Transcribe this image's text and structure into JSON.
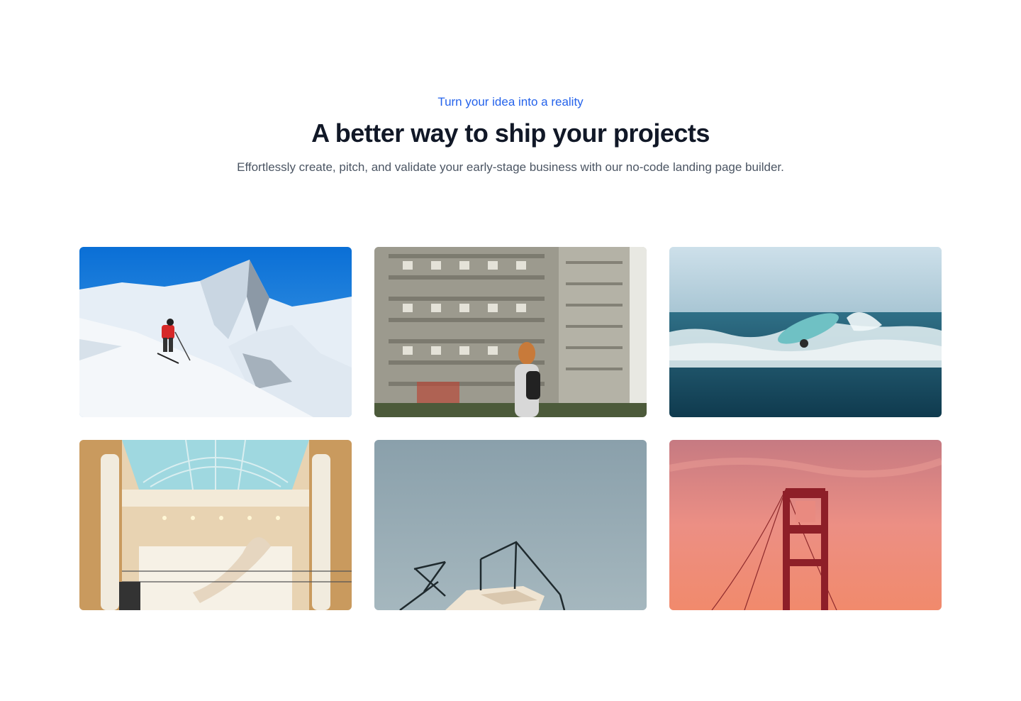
{
  "header": {
    "eyebrow": "Turn your idea into a reality",
    "title": "A better way to ship your projects",
    "subtitle": "Effortlessly create, pitch, and validate your early-stage business with our no-code landing page builder."
  },
  "colors": {
    "accent": "#2563eb",
    "heading": "#111827",
    "body_text": "#4b5563",
    "background": "#ffffff"
  },
  "gallery": {
    "images": [
      {
        "subject": "skier-on-snowy-mountain"
      },
      {
        "subject": "woman-walking-past-apartment-building"
      },
      {
        "subject": "surfer-in-ocean-wave"
      },
      {
        "subject": "atrium-with-spiral-staircase"
      },
      {
        "subject": "rooftop-structure-against-sky"
      },
      {
        "subject": "golden-gate-bridge-tower-at-sunset"
      }
    ]
  }
}
